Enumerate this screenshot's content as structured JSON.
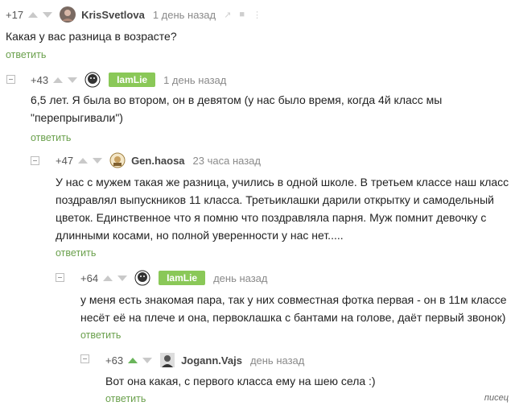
{
  "comments": [
    {
      "score": "+17",
      "author": "KrisSvetlova",
      "date": "1 день назад",
      "text": "Какая у вас разница в возрасте?",
      "reply": "ответить"
    },
    {
      "score": "+43",
      "author": "IamLie",
      "date": "1 день назад",
      "text_line1": "6,5 лет. Я была во втором, он в девятом (у нас было время, когда 4й класс мы",
      "text_line2": "\"перепрыгивали\")",
      "reply": "ответить"
    },
    {
      "score": "+47",
      "author": "Gen.haosa",
      "date": "23 часа назад",
      "text_line1": "У нас с мужем такая же разница, учились в одной школе. В третьем классе наш класс",
      "text_line2": "поздравлял выпускников 11 класса. Третьиклашки дарили открытку и самодельный",
      "text_line3": "цветок. Единственное что я помню что поздравляла парня. Муж помнит девочку с",
      "text_line4": "длинными косами, но полной уверенности у нас нет.....",
      "reply": "ответить"
    },
    {
      "score": "+64",
      "author": "IamLie",
      "date": "день назад",
      "text_line1": "у меня есть знакомая пара, так у них совместная фотка первая - он в 11м классе",
      "text_line2": "несёт её на плече и она, первоклашка  с бантами на голове, даёт первый звонок)",
      "reply": "ответить"
    },
    {
      "score": "+63",
      "author": "Jogann.Vajs",
      "date": "день назад",
      "text": "Вот она какая, с первого класса ему на шею села :)",
      "reply": "ответить"
    }
  ],
  "watermark": "писец",
  "colors": {
    "accent": "#6aa04c",
    "badge": "#8ac858",
    "upvote_active": "#6ab55b",
    "arrow": "#c9c9c9"
  }
}
